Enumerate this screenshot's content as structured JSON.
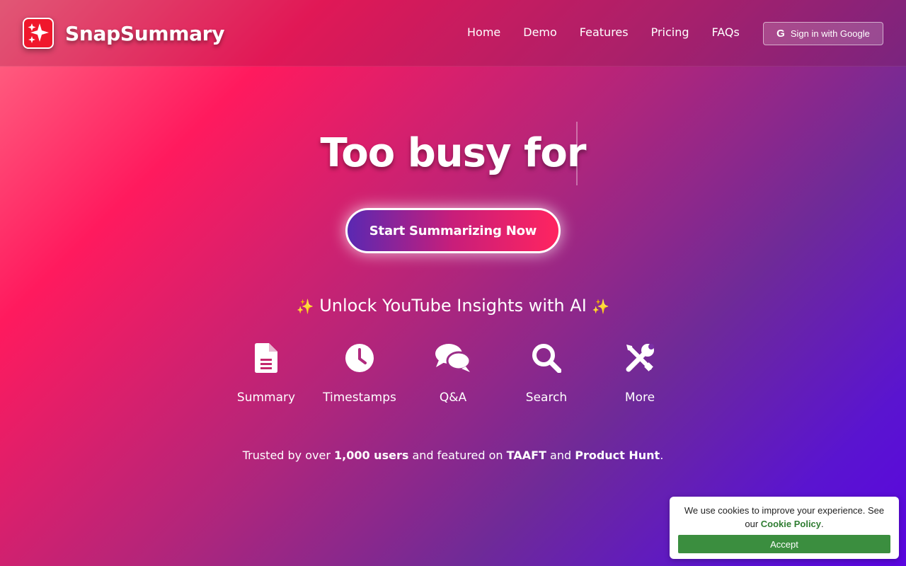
{
  "brand": {
    "name": "SnapSummary",
    "logo_icon": "sparkles-icon",
    "logo_color": "#f0172c"
  },
  "nav": {
    "links": [
      {
        "label": "Home"
      },
      {
        "label": "Demo"
      },
      {
        "label": "Features"
      },
      {
        "label": "Pricing"
      },
      {
        "label": "FAQs"
      }
    ],
    "signin_label": "Sign in with Google",
    "signin_icon": "google-icon"
  },
  "hero": {
    "title": "Too busy for",
    "cta_label": "Start Summarizing Now",
    "subtitle": "Unlock YouTube Insights with AI",
    "subtitle_icon": "sparkles-icon"
  },
  "features": [
    {
      "label": "Summary",
      "icon": "document-icon"
    },
    {
      "label": "Timestamps",
      "icon": "clock-icon"
    },
    {
      "label": "Q&A",
      "icon": "chat-bubbles-icon"
    },
    {
      "label": "Search",
      "icon": "search-icon"
    },
    {
      "label": "More",
      "icon": "tools-icon"
    }
  ],
  "trust": {
    "t1": "Trusted by over ",
    "users": "1,000 users",
    "t2": " and featured on ",
    "taaft": "TAAFT",
    "t3": " and ",
    "product_hunt": "Product Hunt",
    "t4": "."
  },
  "cookie": {
    "text": "We use cookies to improve your experience. See our ",
    "policy_label": "Cookie Policy",
    "text_end": ".",
    "accept_label": "Accept",
    "accept_color": "#3b8e3f",
    "policy_color": "#2f7d32"
  },
  "colors": {
    "accent_pink": "#ff1a5e",
    "accent_purple": "#5a05e0"
  }
}
